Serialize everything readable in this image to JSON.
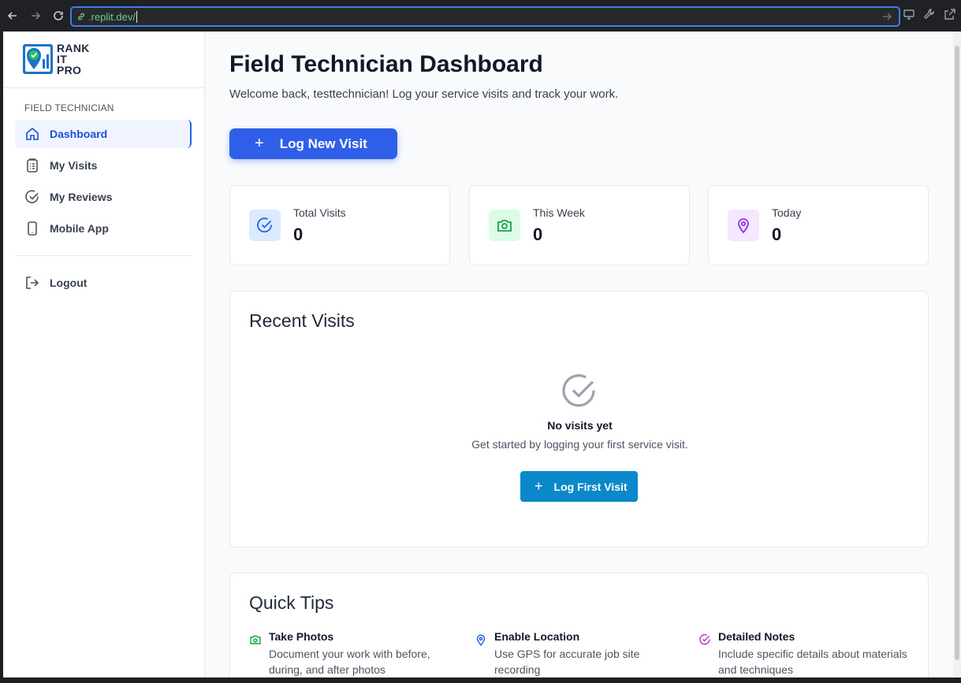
{
  "browser": {
    "url": ".replit.dev/"
  },
  "sidebar": {
    "logo_lines": [
      "RANK",
      "IT",
      "PRO"
    ],
    "section_label": "FIELD TECHNICIAN",
    "items": [
      {
        "label": "Dashboard",
        "icon": "home-icon",
        "active": true
      },
      {
        "label": "My Visits",
        "icon": "clipboard-icon",
        "active": false
      },
      {
        "label": "My Reviews",
        "icon": "check-circle-icon",
        "active": false
      },
      {
        "label": "Mobile App",
        "icon": "smartphone-icon",
        "active": false
      }
    ],
    "logout_label": "Logout"
  },
  "header": {
    "title": "Field Technician Dashboard",
    "subtitle": "Welcome back, testtechnician! Log your service visits and track your work.",
    "primary_button": "Log New Visit"
  },
  "stats": [
    {
      "label": "Total Visits",
      "value": "0",
      "icon": "check-circle-icon",
      "bg": "#dbeafe",
      "color": "#2563eb"
    },
    {
      "label": "This Week",
      "value": "0",
      "icon": "camera-icon",
      "bg": "#dcfce7",
      "color": "#16a34a"
    },
    {
      "label": "Today",
      "value": "0",
      "icon": "map-pin-icon",
      "bg": "#f3e8ff",
      "color": "#9333ea"
    }
  ],
  "recent_visits": {
    "title": "Recent Visits",
    "empty_title": "No visits yet",
    "empty_subtitle": "Get started by logging your first service visit.",
    "button": "Log First Visit"
  },
  "quick_tips": {
    "title": "Quick Tips",
    "tips": [
      {
        "title": "Take Photos",
        "desc": "Document your work with before, during, and after photos",
        "icon": "camera-icon",
        "color": "#16a34a"
      },
      {
        "title": "Enable Location",
        "desc": "Use GPS for accurate job site recording",
        "icon": "map-pin-icon",
        "color": "#2563eb"
      },
      {
        "title": "Detailed Notes",
        "desc": "Include specific details about materials and techniques",
        "icon": "check-circle-icon",
        "color": "#c026d3"
      }
    ]
  },
  "colors": {
    "primary": "#2f5fe8",
    "secondary": "#0b88c9",
    "active_nav": "#1d4ed8"
  }
}
